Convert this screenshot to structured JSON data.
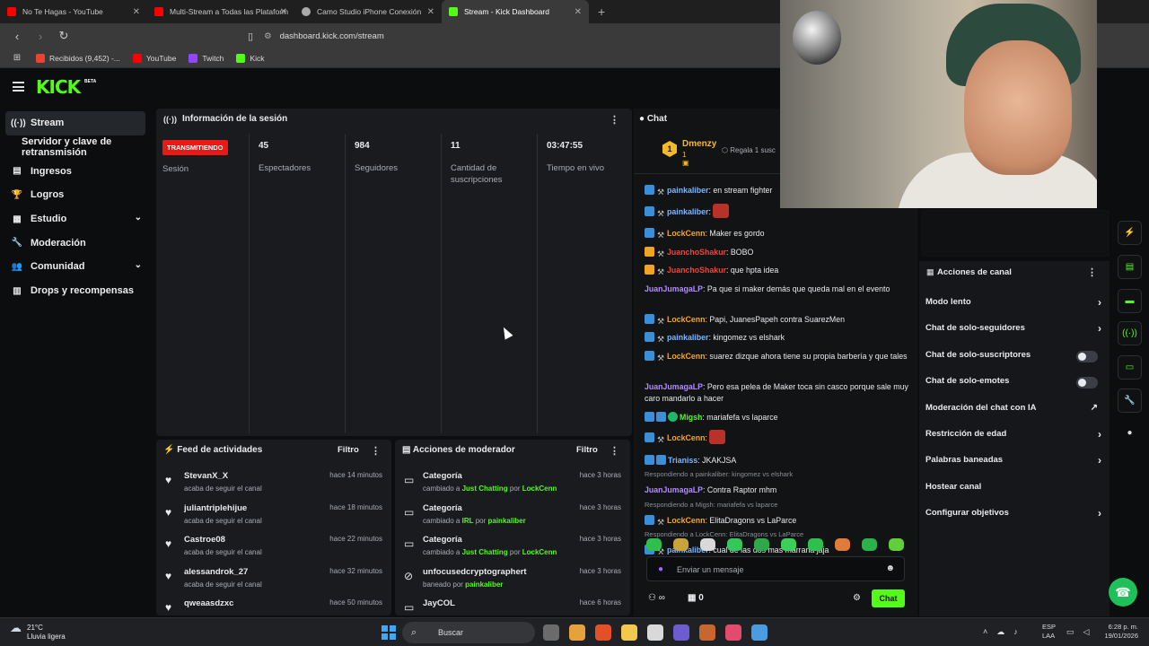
{
  "browser": {
    "tabs": [
      {
        "title": "No Te Hagas - YouTube",
        "color": "#ff0000",
        "active": false
      },
      {
        "title": "Multi-Stream a Todas las Plataform",
        "color": "#ff0000",
        "active": false
      },
      {
        "title": "Camo Studio iPhone Conexión",
        "color": "#aaaaaa",
        "active": false
      },
      {
        "title": "Stream - Kick Dashboard",
        "color": "#53fc18",
        "active": true
      }
    ],
    "url": "dashboard.kick.com/stream",
    "bookmarks": [
      "Recibidos (9,452) -...",
      "YouTube",
      "Twitch",
      "Kick"
    ]
  },
  "header": {
    "logo": "KICK",
    "beta": "BETA"
  },
  "sidebar": {
    "items": [
      {
        "label": "Stream",
        "icon": "broadcast-icon",
        "glyph": "((·))",
        "active": true
      },
      {
        "label": "Servidor y clave de retransmisión",
        "icon": "",
        "glyph": "",
        "sub": true
      },
      {
        "label": "Ingresos",
        "icon": "money-icon",
        "glyph": "▤"
      },
      {
        "label": "Logros",
        "icon": "trophy-icon",
        "glyph": "🏆"
      },
      {
        "label": "Estudio",
        "icon": "studio-icon",
        "glyph": "▦",
        "chevron": true
      },
      {
        "label": "Moderación",
        "icon": "wrench-icon",
        "glyph": "🔧"
      },
      {
        "label": "Comunidad",
        "icon": "community-icon",
        "glyph": "👥",
        "chevron": true
      },
      {
        "label": "Drops y recompensas",
        "icon": "drops-icon",
        "glyph": "▥"
      }
    ]
  },
  "session": {
    "title": "Información de la sesión",
    "live_badge": "TRANSMITIENDO",
    "session_label": "Sesión",
    "stats": [
      {
        "value": "45",
        "label": "Espectadores"
      },
      {
        "value": "984",
        "label": "Seguidores"
      },
      {
        "value": "11",
        "label": "Cantidad de suscripciones"
      },
      {
        "value": "03:47:55",
        "label": "Tiempo en vivo"
      }
    ]
  },
  "activity_feed": {
    "title": "Feed de actividades",
    "filter": "Filtro",
    "items": [
      {
        "name": "StevanX_X",
        "sub": "acaba de seguir el canal",
        "time": "hace 14 minutos"
      },
      {
        "name": "juliantriplehijue",
        "sub": "acaba de seguir el canal",
        "time": "hace 18 minutos"
      },
      {
        "name": "Castroe08",
        "sub": "acaba de seguir el canal",
        "time": "hace 22 minutos"
      },
      {
        "name": "alessandrok_27",
        "sub": "acaba de seguir el canal",
        "time": "hace 32 minutos"
      },
      {
        "name": "qweaasdzxc",
        "sub": "",
        "time": "hace 50 minutos"
      }
    ]
  },
  "mod_actions": {
    "title": "Acciones de moderador",
    "filter": "Filtro",
    "items": [
      {
        "name": "Categoría",
        "pre": "cambiado a ",
        "target": "Just Chatting",
        "mid": " por ",
        "by": "LockCenn",
        "time": "hace 3 horas",
        "icon": "category-icon",
        "glyph": "▭"
      },
      {
        "name": "Categoría",
        "pre": "cambiado a ",
        "target": "IRL",
        "mid": " por ",
        "by": "painkaliber",
        "time": "hace 3 horas",
        "icon": "category-icon",
        "glyph": "▭"
      },
      {
        "name": "Categoría",
        "pre": "cambiado a ",
        "target": "Just Chatting",
        "mid": " por ",
        "by": "LockCenn",
        "time": "hace 3 horas",
        "icon": "category-icon",
        "glyph": "▭"
      },
      {
        "name": "unfocusedcryptographert",
        "pre": "baneado por ",
        "target": "painkaliber",
        "mid": "",
        "by": "",
        "time": "hace 3 horas",
        "icon": "ban-icon",
        "glyph": "⊘"
      },
      {
        "name": "JayCOL",
        "pre": "",
        "target": "",
        "mid": "",
        "by": "",
        "time": "hace 6 horas",
        "icon": "category-icon",
        "glyph": "▭"
      }
    ]
  },
  "chat": {
    "title": "Chat",
    "pinned": {
      "rank": "1",
      "user": "Dmenzy",
      "count": "1",
      "gift": "Regala 1 susc"
    },
    "messages": [
      {
        "user": "painkaliber",
        "color": "#7fb6ff",
        "text": ": en stream fighter",
        "badges": [
          "blue",
          "grey"
        ]
      },
      {
        "user": "painkaliber",
        "color": "#7fb6ff",
        "text": ": ",
        "badges": [
          "blue",
          "grey"
        ],
        "emote": "#b8322a"
      },
      {
        "user": "LockCenn",
        "color": "#f5a623",
        "text": ": Maker es gordo",
        "badges": [
          "blue",
          "grey"
        ]
      },
      {
        "user": "JuanchoShakur",
        "color": "#e9473f",
        "text": ": BOBO",
        "badges": [
          "gold",
          "grey"
        ]
      },
      {
        "user": "JuanchoShakur",
        "color": "#e9473f",
        "text": ": que hpta idea",
        "badges": [
          "gold",
          "grey"
        ]
      },
      {
        "user": "JuanJumagaLP",
        "color": "#b48cff",
        "text": ": Pa que si maker demás que queda mal en el evento",
        "badges": []
      },
      {
        "user": "LockCenn",
        "color": "#f5a623",
        "text": ": Papi, JuanesPapeh contra SuarezMen",
        "badges": [
          "blue",
          "grey"
        ]
      },
      {
        "user": "painkaliber",
        "color": "#7fb6ff",
        "text": ": kingomez vs elshark",
        "badges": [
          "blue",
          "grey"
        ]
      },
      {
        "user": "LockCenn",
        "color": "#f5a623",
        "text": ": suarez dizque ahora tiene su propia barbería y que tales",
        "badges": [
          "blue",
          "grey"
        ]
      },
      {
        "user": "JuanJumagaLP",
        "color": "#b48cff",
        "text": ": Pero esa pelea de Maker toca sin casco porque sale muy caro mandarlo a hacer",
        "badges": []
      },
      {
        "user": "Migsh",
        "color": "#53fc18",
        "text": ": mariafefa vs laparce",
        "badges": [
          "blue",
          "blue",
          "green"
        ]
      },
      {
        "user": "LockCenn",
        "color": "#f5a623",
        "text": ": ",
        "badges": [
          "blue",
          "grey"
        ],
        "emote": "#b8322a"
      },
      {
        "user": "Trianiss",
        "color": "#7fb6ff",
        "text": ": JKAKJSA",
        "badges": [
          "blue",
          "blue"
        ]
      },
      {
        "reply": "Respondiendo a painkaliber: kingomez vs elshark",
        "user": "JuanJumagaLP",
        "color": "#b48cff",
        "text": ": Contra Raptor mhm",
        "badges": []
      },
      {
        "reply": "Respondiendo a Migsh: mariafefa vs laparce",
        "user": "LockCenn",
        "color": "#f5a623",
        "text": ": ElitaDragons vs LaParce",
        "badges": [
          "blue",
          "grey"
        ]
      },
      {
        "reply": "Respondiendo a LockCenn: ElitaDragons vs LaParce",
        "user": "painkaliber",
        "color": "#7fb6ff",
        "text": ": cual de las dos mas marrana jaja",
        "badges": [
          "blue",
          "grey"
        ]
      }
    ],
    "emote_colors": [
      "#2ebf4f",
      "#c9a33b",
      "#d9d9d9",
      "#34c759",
      "#2ea84a",
      "#3ccf5a",
      "#2fbf4f",
      "#e07b3a",
      "#2bb24a",
      "#5fcf3a"
    ],
    "input_placeholder": "Enviar un mensaje",
    "footer_infinity": "∞",
    "footer_count": "0",
    "send_label": "Chat"
  },
  "channel_actions": {
    "title": "Acciones de canal",
    "rows": [
      {
        "label": "Modo lento",
        "control": "chevron"
      },
      {
        "label": "Chat de solo-seguidores",
        "control": "chevron"
      },
      {
        "label": "Chat de solo-suscriptores",
        "control": "toggle"
      },
      {
        "label": "Chat de solo-emotes",
        "control": "toggle"
      },
      {
        "label": "Moderación del chat con IA",
        "control": "external"
      },
      {
        "label": "Restricción de edad",
        "control": "chevron"
      },
      {
        "label": "Palabras baneadas",
        "control": "chevron"
      },
      {
        "label": "Hostear canal",
        "control": "none"
      },
      {
        "label": "Configurar objetivos",
        "control": "chevron"
      }
    ]
  },
  "right_icons": [
    "lightning-icon",
    "document-icon",
    "chat-bubble-icon",
    "broadcast-icon",
    "layout-icon",
    "wrench-icon",
    "drops-icon"
  ],
  "right_glyphs": [
    "⚡",
    "▤",
    "▬",
    "((·))",
    "▭",
    "🔧",
    "●"
  ],
  "taskbar": {
    "temp": "21°C",
    "weather": "Lluvia ligera",
    "search": "Buscar",
    "lang1": "ESP",
    "lang2": "LAA",
    "time": "6:28 p. m.",
    "date": "19/01/2026",
    "app_colors": [
      "#6b6b6b",
      "#e6a13a",
      "#e34f26",
      "#f2c94c",
      "#d9d9d9",
      "#6d5bd0",
      "#c7662e",
      "#e24b6b",
      "#4a9be0"
    ]
  }
}
